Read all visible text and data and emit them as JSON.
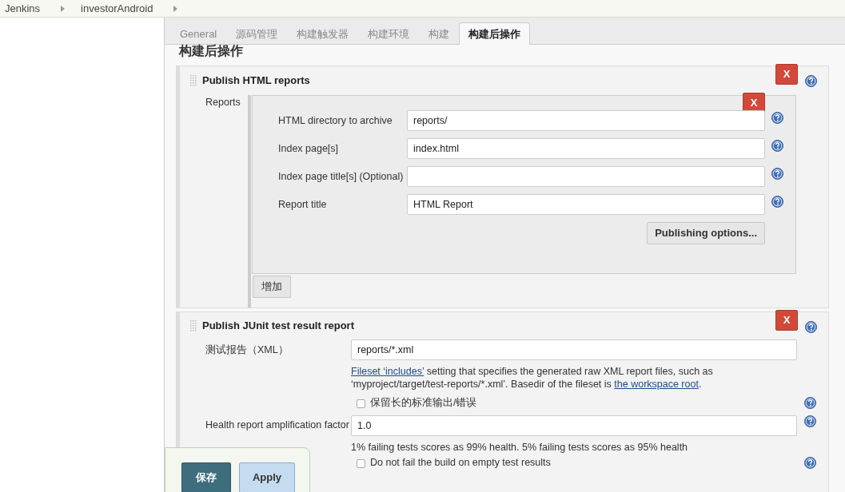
{
  "breadcrumbs": [
    "Jenkins",
    "investorAndroid"
  ],
  "tabs": [
    {
      "label": "General",
      "selected": false
    },
    {
      "label": "源码管理",
      "selected": false
    },
    {
      "label": "构建触发器",
      "selected": false
    },
    {
      "label": "构建环境",
      "selected": false
    },
    {
      "label": "构建",
      "selected": false
    },
    {
      "label": "构建后操作",
      "selected": true
    }
  ],
  "section_heading": "构建后操作",
  "html_publisher": {
    "title": "Publish HTML reports",
    "delete_label": "X",
    "reports_label": "Reports",
    "report": {
      "delete_label": "X",
      "fields": [
        {
          "label": "HTML directory to archive",
          "value": "reports/"
        },
        {
          "label": "Index page[s]",
          "value": "index.html"
        },
        {
          "label": "Index page title[s] (Optional)"
        },
        {
          "label": "Report title",
          "value": "HTML Report"
        }
      ],
      "options_button": "Publishing options..."
    },
    "add_button": "增加"
  },
  "junit": {
    "title": "Publish JUnit test result report",
    "delete_label": "X",
    "rows": [
      {
        "kind": "field",
        "label": "测试报告（XML）",
        "value": "reports/*.xml",
        "help": false
      },
      {
        "kind": "description",
        "parts": [
          {
            "link": "Fileset ‘includes’"
          },
          {
            "text": " setting that specifies the generated raw XML report files, such as ‘myproject/target/test-reports/*.xml’. Basedir of the fileset is "
          },
          {
            "link": "the workspace root"
          },
          {
            "text": "."
          }
        ]
      },
      {
        "kind": "checkbox",
        "label": "保留长的标准输出/错误",
        "checked": false
      },
      {
        "kind": "field",
        "label": "Health report amplification factor",
        "value": "1.0",
        "help": true
      },
      {
        "kind": "note",
        "text": "1% failing tests scores as 99% health. 5% failing tests scores as 95% health"
      },
      {
        "kind": "checkbox",
        "label": "Do not fail the build on empty test results",
        "checked": false
      }
    ]
  },
  "save_bar": {
    "buttons": [
      {
        "label": "保存",
        "kind": "primary"
      },
      {
        "label": "Apply",
        "kind": "secondary"
      }
    ]
  }
}
